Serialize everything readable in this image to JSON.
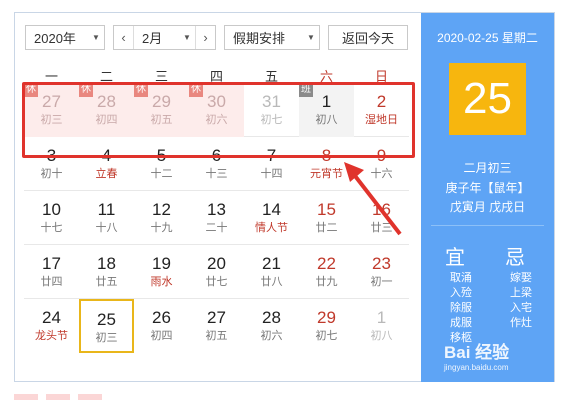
{
  "toolbar": {
    "year": "2020年",
    "prev_month": "‹",
    "month": "2月",
    "next_month": "›",
    "holiday_select": "假期安排",
    "today_button": "返回今天"
  },
  "weekdays": [
    "一",
    "二",
    "三",
    "四",
    "五",
    "六",
    "日"
  ],
  "weeks": [
    [
      {
        "d": "27",
        "l": "初三",
        "state": "holiday",
        "tag": "休"
      },
      {
        "d": "28",
        "l": "初四",
        "state": "holiday",
        "tag": "休"
      },
      {
        "d": "29",
        "l": "初五",
        "state": "holiday",
        "tag": "休"
      },
      {
        "d": "30",
        "l": "初六",
        "state": "holiday",
        "tag": "休"
      },
      {
        "d": "31",
        "l": "初七",
        "state": "other"
      },
      {
        "d": "1",
        "l": "初八",
        "state": "work",
        "tag": "班"
      },
      {
        "d": "2",
        "l": "湿地日",
        "state": "we fest"
      }
    ],
    [
      {
        "d": "3",
        "l": "初十"
      },
      {
        "d": "4",
        "l": "立春",
        "state": "fest"
      },
      {
        "d": "5",
        "l": "十二"
      },
      {
        "d": "6",
        "l": "十三"
      },
      {
        "d": "7",
        "l": "十四"
      },
      {
        "d": "8",
        "l": "元宵节",
        "state": "we fest"
      },
      {
        "d": "9",
        "l": "十六",
        "state": "we"
      }
    ],
    [
      {
        "d": "10",
        "l": "十七"
      },
      {
        "d": "11",
        "l": "十八"
      },
      {
        "d": "12",
        "l": "十九"
      },
      {
        "d": "13",
        "l": "二十"
      },
      {
        "d": "14",
        "l": "情人节",
        "state": "fest"
      },
      {
        "d": "15",
        "l": "廿二",
        "state": "we"
      },
      {
        "d": "16",
        "l": "廿三",
        "state": "we"
      }
    ],
    [
      {
        "d": "17",
        "l": "廿四"
      },
      {
        "d": "18",
        "l": "廿五"
      },
      {
        "d": "19",
        "l": "雨水",
        "state": "fest"
      },
      {
        "d": "20",
        "l": "廿七"
      },
      {
        "d": "21",
        "l": "廿八"
      },
      {
        "d": "22",
        "l": "廿九",
        "state": "we"
      },
      {
        "d": "23",
        "l": "初一",
        "state": "we"
      }
    ],
    [
      {
        "d": "24",
        "l": "龙头节",
        "state": "fest"
      },
      {
        "d": "25",
        "l": "初三",
        "state": "today"
      },
      {
        "d": "26",
        "l": "初四"
      },
      {
        "d": "27",
        "l": "初五"
      },
      {
        "d": "28",
        "l": "初六"
      },
      {
        "d": "29",
        "l": "初七",
        "state": "we"
      },
      {
        "d": "1",
        "l": "初八",
        "state": "other"
      }
    ]
  ],
  "panel": {
    "date_line": "2020-02-25 星期二",
    "day": "25",
    "lunar": "二月初三",
    "ganzhi_year": "庚子年【鼠年】",
    "ganzhi_month_day": "戊寅月 戊戌日",
    "yi_title": "宜",
    "ji_title": "忌",
    "yi_items": [
      "取涌",
      "入殓",
      "除服",
      "成服",
      "移柩"
    ],
    "ji_items": [
      "嫁娶",
      "上梁",
      "入宅",
      "作灶"
    ]
  },
  "watermark": {
    "main": "Bai 经验",
    "sub": "jingyan.baidu.com"
  },
  "colors": {
    "accent": "#5ea4f5",
    "day_box": "#f7b60e",
    "weekend": "#c0392b",
    "highlight_border": "#e0332c"
  }
}
